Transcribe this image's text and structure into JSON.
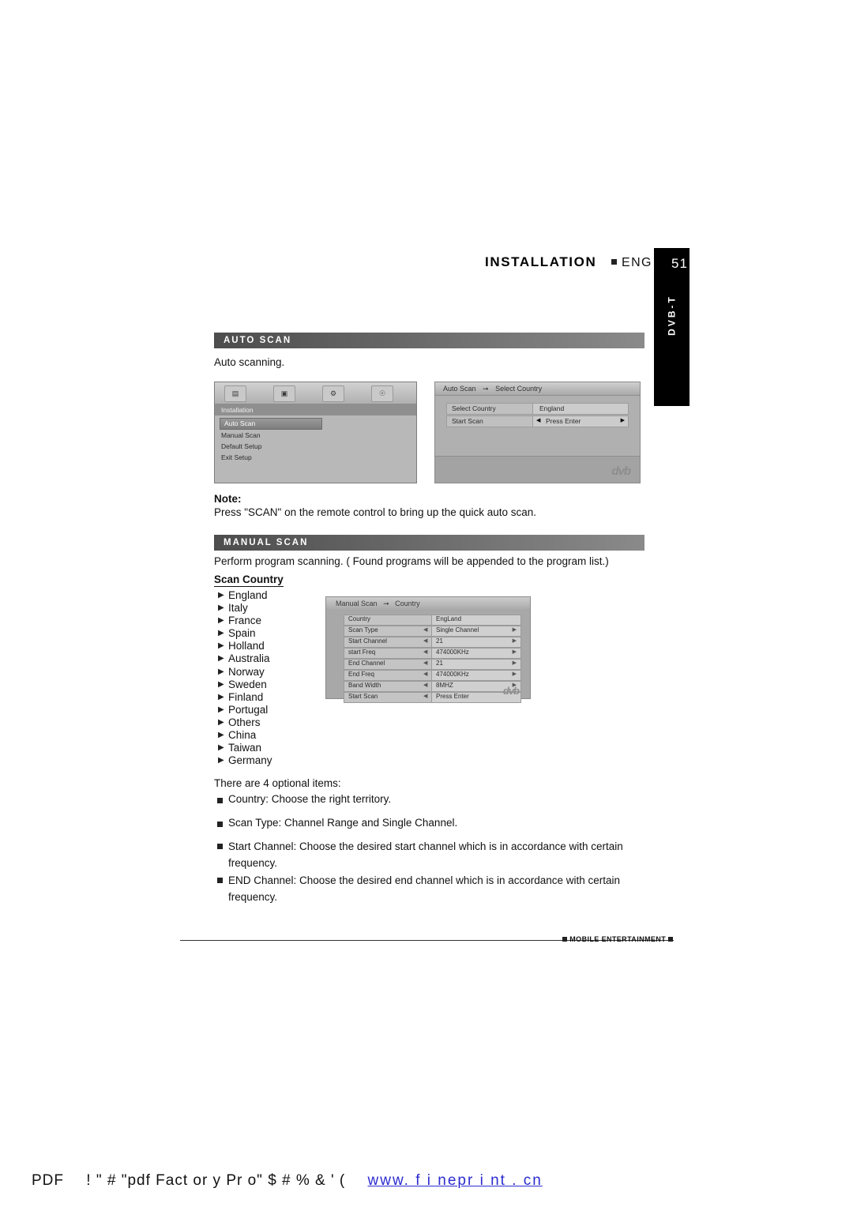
{
  "header": {
    "title": "INSTALLATION",
    "lang": "ENG",
    "page_number": "51",
    "side_tab": "DVB-T"
  },
  "sections": {
    "auto_scan": {
      "bar_label": "AUTO SCAN",
      "body": "Auto  scanning.",
      "note_label": "Note:",
      "note_text": "Press \"SCAN\" on the remote control to bring up the quick auto scan."
    },
    "manual_scan": {
      "bar_label": "MANUAL SCAN",
      "intro": "Perform program scanning. ( Found programs will be appended to the program list.)",
      "scan_country_label": "Scan Country",
      "countries": [
        "England",
        "Italy",
        "France",
        "Spain",
        "Holland",
        "Australia",
        "Norway",
        "Sweden",
        "Finland",
        "Portugal",
        "Others",
        "China",
        "Taiwan",
        "Germany"
      ],
      "optional_intro": "There are 4 optional items:",
      "options": [
        "Country: Choose the right territory.",
        "Scan Type: Channel Range and Single Channel.",
        "Start Channel: Choose the desired start channel which is in accordance with certain frequency.",
        "END Channel: Choose the desired end channel which is in accordance with certain frequency."
      ]
    }
  },
  "osd_install": {
    "icons": [
      "tuner-icon",
      "picture-icon",
      "settings-icon",
      "installation-icon"
    ],
    "subtitle": "Installation",
    "menu_items": [
      "Auto Scan",
      "Manual Scan",
      "Default Setup",
      "Exit Setup"
    ],
    "selected": "Auto Scan"
  },
  "osd_autoscan": {
    "title_left": "Auto Scan",
    "title_right": "Select Country",
    "rows": [
      {
        "label": "Select  Country",
        "value": "England"
      },
      {
        "label": "Start Scan",
        "value": "Press Enter"
      }
    ],
    "logo": "dvb"
  },
  "osd_manual": {
    "title_left": "Manual Scan",
    "title_right": "Country",
    "rows": [
      {
        "label": "Country",
        "value": "EngLand",
        "left_arrow": "",
        "right_arrow": ""
      },
      {
        "label": "Scan Type",
        "value": "Single Channel",
        "left_arrow": "◀",
        "right_arrow": "▶"
      },
      {
        "label": "Start Channel",
        "value": "21",
        "left_arrow": "◀",
        "right_arrow": "▶"
      },
      {
        "label": "start Freq",
        "value": "474000KHz",
        "left_arrow": "◀",
        "right_arrow": "▶"
      },
      {
        "label": "End Channel",
        "value": "21",
        "left_arrow": "◀",
        "right_arrow": "▶"
      },
      {
        "label": "End Freq",
        "value": "474000KHz",
        "left_arrow": "◀",
        "right_arrow": "▶"
      },
      {
        "label": "Band Width",
        "value": "8MHZ",
        "left_arrow": "◀",
        "right_arrow": "▶"
      },
      {
        "label": "Start Scan",
        "value": "Press Enter",
        "left_arrow": "◀",
        "right_arrow": ""
      }
    ],
    "logo": "dvb"
  },
  "footer": {
    "text": "MOBILE ENTERTAINMENT"
  },
  "pdf_bar": {
    "prefix": "PDF",
    "middle": "!  \"  #   \"pdf Fact or y  Pr o\"  $  #  %  &  '  (",
    "link": "www. f i nepr i nt . cn"
  }
}
